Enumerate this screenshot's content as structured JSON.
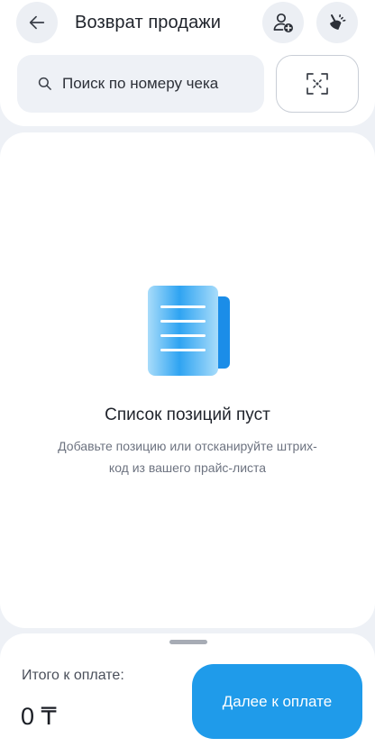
{
  "header": {
    "title": "Возврат продажи",
    "back_icon": "arrow-left-icon",
    "add_client_icon": "user-plus-icon",
    "clean_icon": "broom-icon"
  },
  "search": {
    "placeholder": "Поиск по номеру чека",
    "value": "",
    "icon": "search-icon",
    "scan_icon": "barcode-scan-icon"
  },
  "empty_state": {
    "icon": "document-list-icon",
    "title": "Список позиций пуст",
    "description": "Добавьте позицию или отсканируйте штрих-код из вашего прайс-листа"
  },
  "footer": {
    "total_label": "Итого к оплате:",
    "total_value": "0 ₸",
    "pay_button_label": "Далее к оплате"
  },
  "colors": {
    "accent": "#1f9bea",
    "background": "#eef1f6",
    "surface": "#ffffff"
  }
}
